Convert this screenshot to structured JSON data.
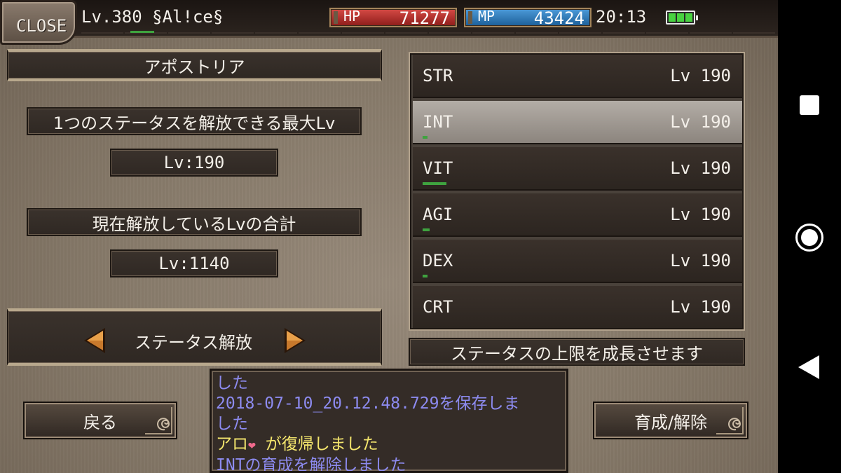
{
  "topbar": {
    "close_label": "CLOSE",
    "player": "Lv.380 §Al!ce§",
    "hp_label": "HP",
    "hp_value": "71277",
    "mp_label": "MP",
    "mp_value": "43424",
    "clock": "20:13",
    "battery_icon": "battery-full-icon"
  },
  "left": {
    "title": "アポストリア",
    "max_label": "1つのステータスを解放できる最大Lv",
    "max_value": "Lv:190",
    "total_label": "現在解放しているLvの合計",
    "total_value": "Lv:1140",
    "release_label": "ステータス解放"
  },
  "stats": [
    {
      "name": "STR",
      "lv": "Lv 190",
      "progress": 0.0
    },
    {
      "name": "INT",
      "lv": "Lv 190",
      "progress": 0.02
    },
    {
      "name": "VIT",
      "lv": "Lv 190",
      "progress": 0.1
    },
    {
      "name": "AGI",
      "lv": "Lv 190",
      "progress": 0.03
    },
    {
      "name": "DEX",
      "lv": "Lv 190",
      "progress": 0.02
    },
    {
      "name": "CRT",
      "lv": "Lv 190",
      "progress": 0.0
    }
  ],
  "selected_stat": "INT",
  "description": "ステータスの上限を成長させます",
  "buttons": {
    "back": "戻る",
    "train_release": "育成/解除"
  },
  "log": {
    "line1": " した",
    "line2": "2018-07-10_20.12.48.729を保存しま",
    "line3": " した",
    "line4_name": "アロ",
    "line4_rest": " が復帰しました",
    "line5": "INTの育成を解除しました"
  },
  "colors": {
    "hp": "#c0392b",
    "mp": "#2f7fc1",
    "progress": "#3fa33f",
    "log_system": "#8d8bf0",
    "log_player": "#f4e66d"
  }
}
